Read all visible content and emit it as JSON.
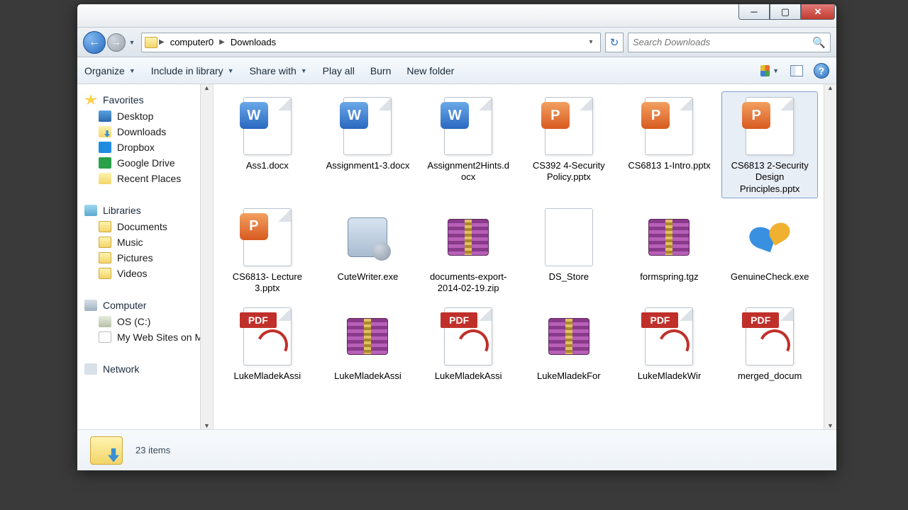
{
  "breadcrumb": {
    "seg1": "computer0",
    "seg2": "Downloads"
  },
  "search": {
    "placeholder": "Search Downloads"
  },
  "toolbar": {
    "organize": "Organize",
    "include": "Include in library",
    "share": "Share with",
    "play": "Play all",
    "burn": "Burn",
    "newfolder": "New folder"
  },
  "sidebar": {
    "favorites": {
      "label": "Favorites",
      "items": [
        "Desktop",
        "Downloads",
        "Dropbox",
        "Google Drive",
        "Recent Places"
      ]
    },
    "libraries": {
      "label": "Libraries",
      "items": [
        "Documents",
        "Music",
        "Pictures",
        "Videos"
      ]
    },
    "computer": {
      "label": "Computer",
      "items": [
        "OS (C:)",
        "My Web Sites on M"
      ]
    },
    "network": {
      "label": "Network"
    }
  },
  "files": [
    {
      "name": "Ass1.docx",
      "type": "word"
    },
    {
      "name": "Assignment1-3.docx",
      "type": "word"
    },
    {
      "name": "Assignment2Hints.docx",
      "type": "word"
    },
    {
      "name": "CS392 4-Security Policy.pptx",
      "type": "ppt"
    },
    {
      "name": "CS6813 1-Intro.pptx",
      "type": "ppt"
    },
    {
      "name": "CS6813 2-Security Design Principles.pptx",
      "type": "ppt",
      "selected": true
    },
    {
      "name": "CS6813- Lecture 3.pptx",
      "type": "ppt"
    },
    {
      "name": "CuteWriter.exe",
      "type": "exe"
    },
    {
      "name": "documents-export-2014-02-19.zip",
      "type": "archive"
    },
    {
      "name": "DS_Store",
      "type": "blank"
    },
    {
      "name": "formspring.tgz",
      "type": "archive"
    },
    {
      "name": "GenuineCheck.exe",
      "type": "gc"
    },
    {
      "name": "LukeMladekAssi",
      "type": "pdf"
    },
    {
      "name": "LukeMladekAssi",
      "type": "archive"
    },
    {
      "name": "LukeMladekAssi",
      "type": "pdf"
    },
    {
      "name": "LukeMladekFor",
      "type": "archive"
    },
    {
      "name": "LukeMladekWir",
      "type": "pdf"
    },
    {
      "name": "merged_docum",
      "type": "pdf"
    }
  ],
  "status": {
    "count": "23 items"
  }
}
